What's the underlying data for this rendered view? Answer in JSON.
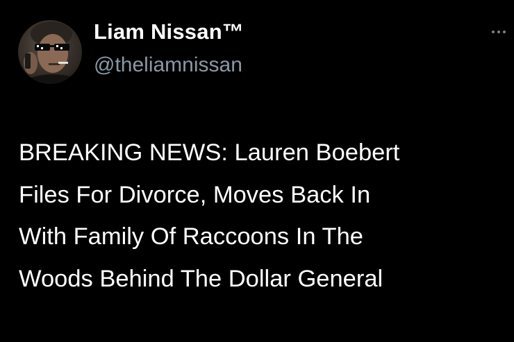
{
  "author": {
    "display_name": "Liam Nissan™",
    "handle": "@theliamnissan",
    "avatar_icon": "avatar-photo-sunglasses"
  },
  "menu": {
    "icon": "more-options-icon"
  },
  "tweet": {
    "lines": [
      "BREAKING NEWS: Lauren Boebert",
      "Files For Divorce, Moves Back In",
      "With Family Of Raccoons In The",
      "Woods Behind The Dollar General"
    ]
  },
  "colors": {
    "background": "#000000",
    "name": "#ffffff",
    "handle": "#8b98a5",
    "text": "#ffffff"
  }
}
